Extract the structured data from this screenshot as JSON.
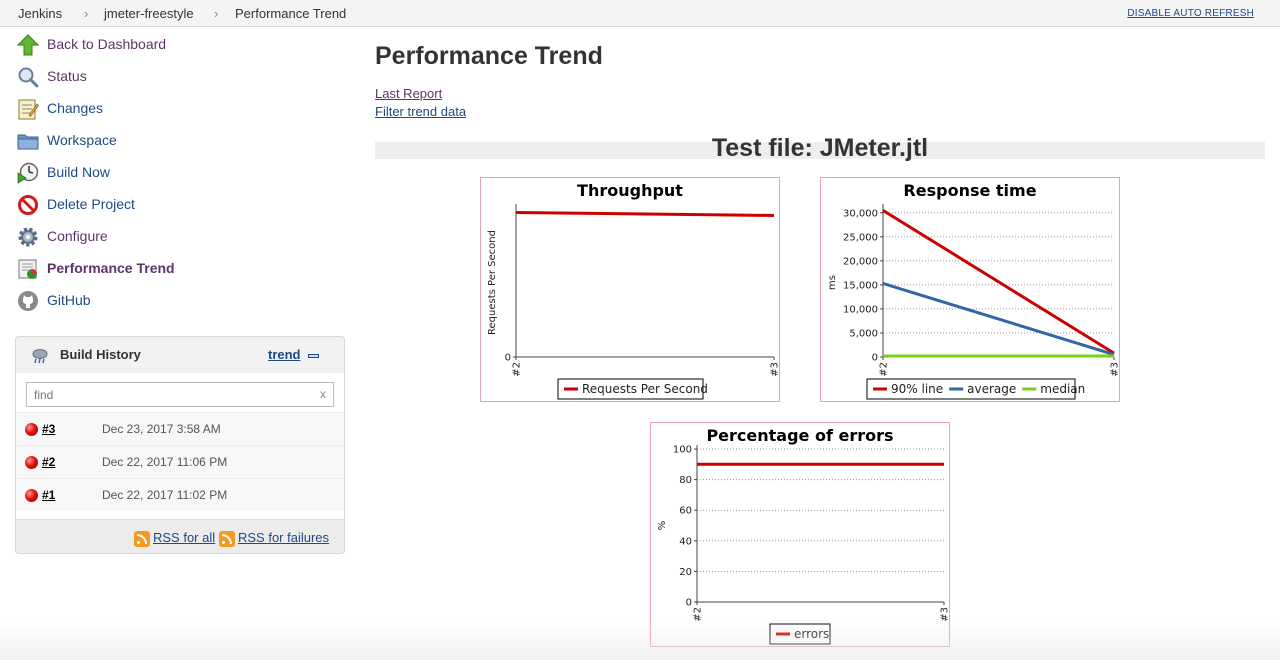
{
  "breadcrumb": {
    "items": [
      "Jenkins",
      "jmeter-freestyle",
      "Performance Trend"
    ],
    "separator": "›"
  },
  "header": {
    "auto_refresh": "DISABLE AUTO REFRESH"
  },
  "sidebar": {
    "tasks": [
      {
        "label": "Back to Dashboard",
        "icon": "up-arrow-icon"
      },
      {
        "label": "Status",
        "icon": "magnifier-icon"
      },
      {
        "label": "Changes",
        "icon": "notepad-icon"
      },
      {
        "label": "Workspace",
        "icon": "folder-icon"
      },
      {
        "label": "Build Now",
        "icon": "clock-play-icon"
      },
      {
        "label": "Delete Project",
        "icon": "no-entry-icon"
      },
      {
        "label": "Configure",
        "icon": "gear-icon"
      },
      {
        "label": "Performance Trend",
        "icon": "performance-chart-icon"
      },
      {
        "label": "GitHub",
        "icon": "github-icon"
      }
    ]
  },
  "build_history": {
    "title": "Build History",
    "trend_label": "trend",
    "find_placeholder": "find",
    "clear_label": "x",
    "builds": [
      {
        "number": "#3",
        "date": "Dec 23, 2017 3:58 AM",
        "status": "failed"
      },
      {
        "number": "#2",
        "date": "Dec 22, 2017 11:06 PM",
        "status": "failed"
      },
      {
        "number": "#1",
        "date": "Dec 22, 2017 11:02 PM",
        "status": "failed"
      }
    ],
    "rss_all": "RSS for all",
    "rss_failures": "RSS for failures"
  },
  "main": {
    "title": "Performance Trend",
    "links": {
      "last_report": "Last Report",
      "filter": "Filter trend data"
    },
    "file_title": "Test file: JMeter.jtl"
  },
  "colors": {
    "red": "#cc0000",
    "blue": "#3465a4",
    "green": "#73d216",
    "link": "#204a87"
  },
  "chart_data": [
    {
      "type": "line",
      "title": "Throughput",
      "ylabel": "Requests Per Second",
      "categories": [
        "#2",
        "#3"
      ],
      "y_ticks": [
        "0"
      ],
      "ylim": [
        0,
        1
      ],
      "grid": false,
      "legend": "bottom",
      "series": [
        {
          "name": "Requests Per Second",
          "values": [
            0.97,
            0.95
          ],
          "color": "#cc0000"
        }
      ]
    },
    {
      "type": "line",
      "title": "Response time",
      "ylabel": "ms",
      "categories": [
        "#2",
        "#3"
      ],
      "y_ticks": [
        "0",
        "5,000",
        "10,000",
        "15,000",
        "20,000",
        "25,000",
        "30,000"
      ],
      "ylim": [
        0,
        31000
      ],
      "grid": true,
      "legend": "bottom",
      "series": [
        {
          "name": "90% line",
          "values": [
            30500,
            800
          ],
          "color": "#cc0000"
        },
        {
          "name": "average",
          "values": [
            15300,
            500
          ],
          "color": "#3465a4"
        },
        {
          "name": "median",
          "values": [
            200,
            200
          ],
          "color": "#73d216"
        }
      ]
    },
    {
      "type": "line",
      "title": "Percentage of errors",
      "ylabel": "%",
      "categories": [
        "#2",
        "#3"
      ],
      "y_ticks": [
        "0",
        "20",
        "40",
        "60",
        "80",
        "100"
      ],
      "ylim": [
        0,
        100
      ],
      "grid": true,
      "legend": "bottom",
      "series": [
        {
          "name": "errors",
          "values": [
            90,
            90
          ],
          "color": "#cc0000"
        }
      ]
    }
  ]
}
